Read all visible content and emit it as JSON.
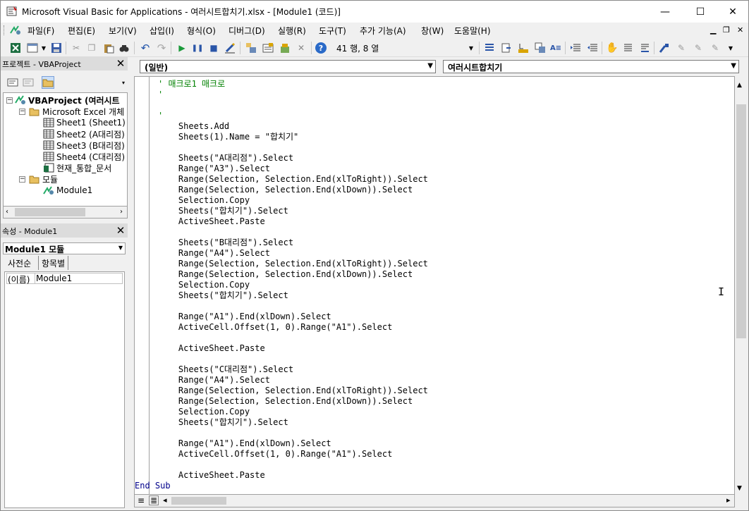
{
  "window": {
    "title": "Microsoft Visual Basic for Applications - 여러시트합치기.xlsx - [Module1 (코드)]",
    "minimize": "—",
    "maximize": "☐",
    "close": "✕"
  },
  "menu": {
    "items": [
      "파일(F)",
      "편집(E)",
      "보기(V)",
      "삽입(I)",
      "형식(O)",
      "디버그(D)",
      "실행(R)",
      "도구(T)",
      "추가 기능(A)",
      "창(W)",
      "도움말(H)"
    ],
    "mdi_controls": [
      "▁",
      "❐",
      "✕"
    ]
  },
  "toolbar": {
    "position": "41 행, 8 열",
    "icons": [
      "excel-icon",
      "insert-module-icon",
      "save-icon",
      "cut-icon",
      "copy-icon",
      "paste-icon",
      "find-icon",
      "undo-icon",
      "redo-icon",
      "run-icon",
      "break-icon",
      "reset-icon",
      "design-mode-icon",
      "project-explorer-icon",
      "properties-icon",
      "object-browser-icon",
      "toolbox-icon",
      "help-icon"
    ]
  },
  "project_pane": {
    "title": "프로젝트 - VBAProject",
    "tree": {
      "root": "VBAProject (여러시트",
      "excel_objects": "Microsoft Excel 개체",
      "sheets": [
        "Sheet1 (Sheet1)",
        "Sheet2 (A대리점)",
        "Sheet3 (B대리점)",
        "Sheet4 (C대리점)",
        "현재_통합_문서"
      ],
      "modules_folder": "모듈",
      "module": "Module1"
    }
  },
  "properties_pane": {
    "title": "속성 - Module1",
    "object_select": "Module1 모듈",
    "tabs": [
      "사전순",
      "항목별"
    ],
    "rows": [
      {
        "name": "(이름)",
        "value": "Module1"
      }
    ]
  },
  "code_window": {
    "object_combo": "(일반)",
    "procedure_combo": "여러시트합치기",
    "lines": [
      {
        "text": "' 매크로1 매크로",
        "cls": "cmt"
      },
      {
        "text": "'",
        "cls": "cmt"
      },
      {
        "text": "",
        "cls": ""
      },
      {
        "text": "'",
        "cls": "cmt"
      },
      {
        "text": "    Sheets.Add",
        "cls": ""
      },
      {
        "text": "    Sheets(1).Name = \"합치기\"",
        "cls": ""
      },
      {
        "text": "",
        "cls": ""
      },
      {
        "text": "    Sheets(\"A대리점\").Select",
        "cls": ""
      },
      {
        "text": "    Range(\"A3\").Select",
        "cls": ""
      },
      {
        "text": "    Range(Selection, Selection.End(xlToRight)).Select",
        "cls": ""
      },
      {
        "text": "    Range(Selection, Selection.End(xlDown)).Select",
        "cls": ""
      },
      {
        "text": "    Selection.Copy",
        "cls": ""
      },
      {
        "text": "    Sheets(\"합치기\").Select",
        "cls": ""
      },
      {
        "text": "    ActiveSheet.Paste",
        "cls": ""
      },
      {
        "text": "",
        "cls": ""
      },
      {
        "text": "    Sheets(\"B대리점\").Select",
        "cls": ""
      },
      {
        "text": "    Range(\"A4\").Select",
        "cls": ""
      },
      {
        "text": "    Range(Selection, Selection.End(xlToRight)).Select",
        "cls": ""
      },
      {
        "text": "    Range(Selection, Selection.End(xlDown)).Select",
        "cls": ""
      },
      {
        "text": "    Selection.Copy",
        "cls": ""
      },
      {
        "text": "    Sheets(\"합치기\").Select",
        "cls": ""
      },
      {
        "text": "",
        "cls": ""
      },
      {
        "text": "    Range(\"A1\").End(xlDown).Select",
        "cls": ""
      },
      {
        "text": "    ActiveCell.Offset(1, 0).Range(\"A1\").Select",
        "cls": ""
      },
      {
        "text": "",
        "cls": ""
      },
      {
        "text": "    ActiveSheet.Paste",
        "cls": ""
      },
      {
        "text": "",
        "cls": ""
      },
      {
        "text": "    Sheets(\"C대리점\").Select",
        "cls": ""
      },
      {
        "text": "    Range(\"A4\").Select",
        "cls": ""
      },
      {
        "text": "    Range(Selection, Selection.End(xlToRight)).Select",
        "cls": ""
      },
      {
        "text": "    Range(Selection, Selection.End(xlDown)).Select",
        "cls": ""
      },
      {
        "text": "    Selection.Copy",
        "cls": ""
      },
      {
        "text": "    Sheets(\"합치기\").Select",
        "cls": ""
      },
      {
        "text": "",
        "cls": ""
      },
      {
        "text": "    Range(\"A1\").End(xlDown).Select",
        "cls": ""
      },
      {
        "text": "    ActiveCell.Offset(1, 0).Range(\"A1\").Select",
        "cls": ""
      },
      {
        "text": "",
        "cls": ""
      },
      {
        "text": "    ActiveSheet.Paste",
        "cls": ""
      },
      {
        "text": "End Sub",
        "cls": "kw"
      }
    ]
  },
  "colors": {
    "comment": "#008000",
    "keyword": "#00008b",
    "pane_header": "#dcdcdc"
  }
}
